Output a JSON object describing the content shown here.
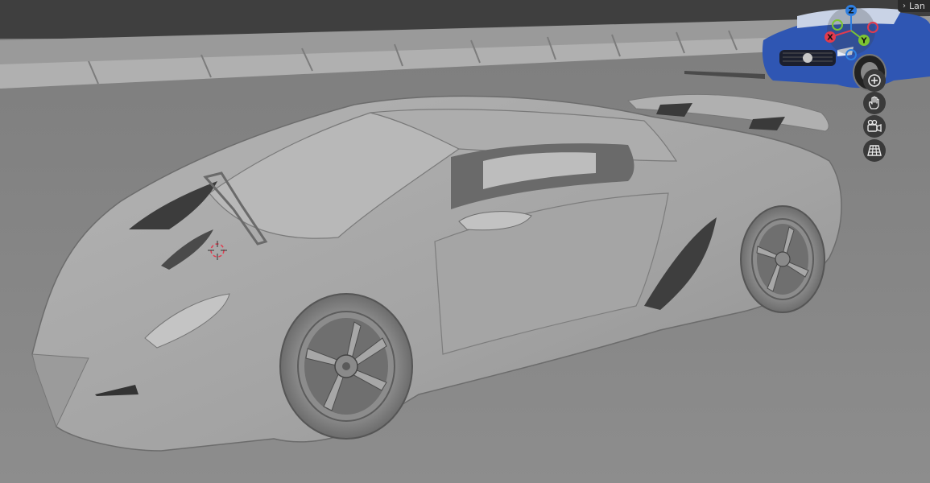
{
  "viewport": {
    "sidebar_tab_label": "Lan",
    "tab_icon": "chevron-right-icon"
  },
  "navigation_gizmo": {
    "axis_z": "Z",
    "axis_x": "X",
    "axis_y": "Y",
    "colors": {
      "x": "#e23b4e",
      "y": "#7cc433",
      "z": "#2f7fe0"
    }
  },
  "viewport_tools": [
    {
      "name": "zoom",
      "icon": "zoom-in-icon"
    },
    {
      "name": "pan",
      "icon": "hand-icon"
    },
    {
      "name": "camera",
      "icon": "camera-icon"
    },
    {
      "name": "ortho",
      "icon": "grid-icon"
    }
  ],
  "scene_colors": {
    "background": "#8a8a8a",
    "model": "#a7a7a7",
    "reference_car": "#2f56b3"
  }
}
